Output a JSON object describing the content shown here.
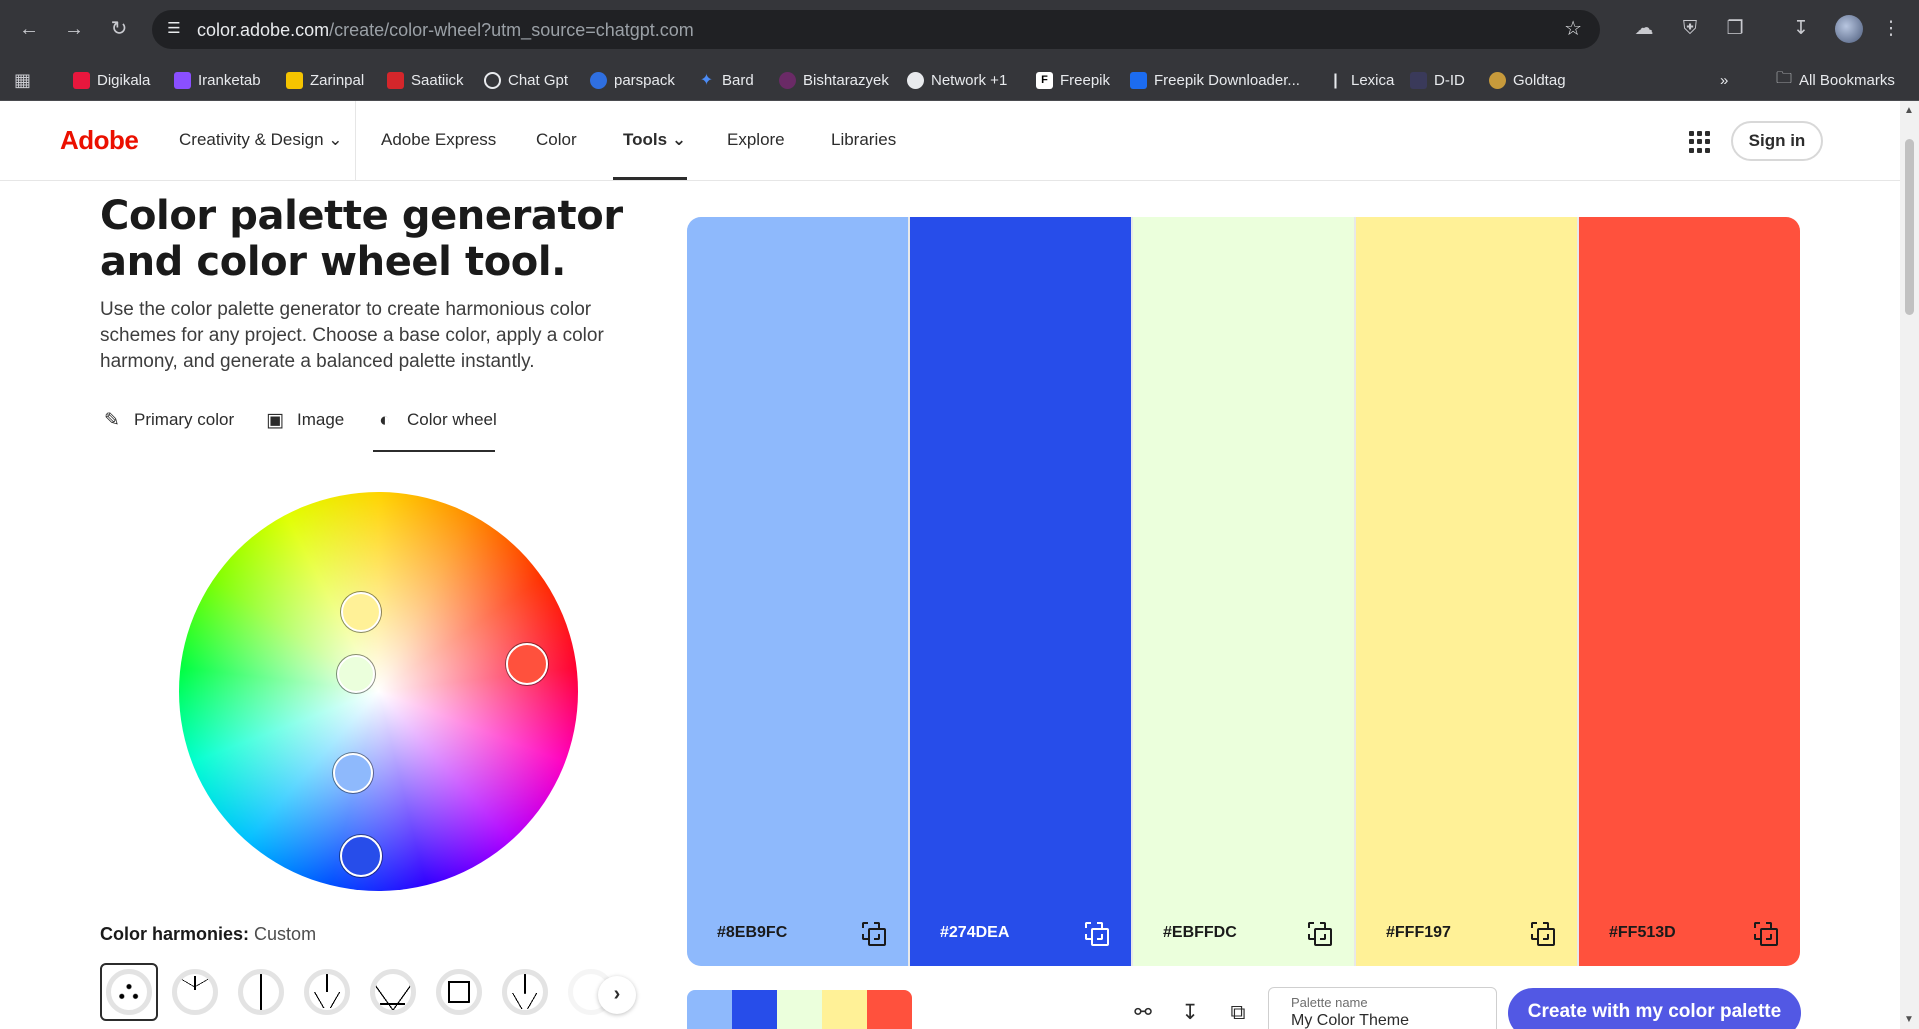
{
  "browser": {
    "url_host": "color.adobe.com",
    "url_path": "/create/color-wheel?utm_source=chatgpt.com",
    "bookmarks": [
      {
        "label": "Digikala",
        "color": "#e8173d"
      },
      {
        "label": "Iranketab",
        "color": "#8a4fff"
      },
      {
        "label": "Zarinpal",
        "color": "#f5c400"
      },
      {
        "label": "Saatiick",
        "color": "#d4262b"
      },
      {
        "label": "Chat Gpt",
        "color": "#ffffff"
      },
      {
        "label": "parspack",
        "color": "#2f6fe0"
      },
      {
        "label": "Bard",
        "color": "#4c8cf6"
      },
      {
        "label": "Bishtarazyek",
        "color": "#6a2a66"
      },
      {
        "label": "Network +1",
        "color": "#ffffff"
      },
      {
        "label": "Freepik",
        "color": "#ffffff"
      },
      {
        "label": "Freepik Downloader...",
        "color": "#1c6cf0"
      },
      {
        "label": "Lexica",
        "color": "#ffffff"
      },
      {
        "label": "D-ID",
        "color": "#3a3a5a"
      },
      {
        "label": "Goldtag",
        "color": "#c79a3b"
      }
    ],
    "more_label": "»",
    "all_bookmarks_label": "All Bookmarks"
  },
  "header": {
    "logo": "Adobe",
    "nav": [
      "Creativity & Design",
      "Adobe Express",
      "Color",
      "Tools",
      "Explore",
      "Libraries"
    ],
    "signin": "Sign in"
  },
  "main": {
    "title": "Color palette generator and color wheel tool.",
    "description": "Use the color palette generator to create harmonious color schemes for any project. Choose a base color, apply a color harmony, and generate a balanced palette instantly.",
    "tabs": [
      {
        "label": "Primary color",
        "icon": "eyedropper-icon"
      },
      {
        "label": "Image",
        "icon": "image-icon"
      },
      {
        "label": "Color wheel",
        "icon": "color-wheel-icon"
      }
    ],
    "active_tab": "Color wheel",
    "harmony_label": "Color harmonies:",
    "harmony_value": "Custom",
    "harmony_options": [
      "custom",
      "analogous",
      "complementary",
      "triad",
      "split-complementary",
      "square",
      "compound"
    ]
  },
  "palette": {
    "swatches": [
      {
        "hex": "#8EB9FC",
        "color": "#8eb9fc",
        "text_color": "#1a1a1a"
      },
      {
        "hex": "#274DEA",
        "color": "#274dea",
        "text_color": "#ffffff"
      },
      {
        "hex": "#EBFFDC",
        "color": "#ebffdc",
        "text_color": "#1a1a1a"
      },
      {
        "hex": "#FFF197",
        "color": "#fff197",
        "text_color": "#1a1a1a"
      },
      {
        "hex": "#FF513D",
        "color": "#ff513d",
        "text_color": "#1a1a1a"
      }
    ],
    "name_label": "Palette name",
    "name_value": "My Color Theme",
    "cta": "Create with my color palette"
  }
}
